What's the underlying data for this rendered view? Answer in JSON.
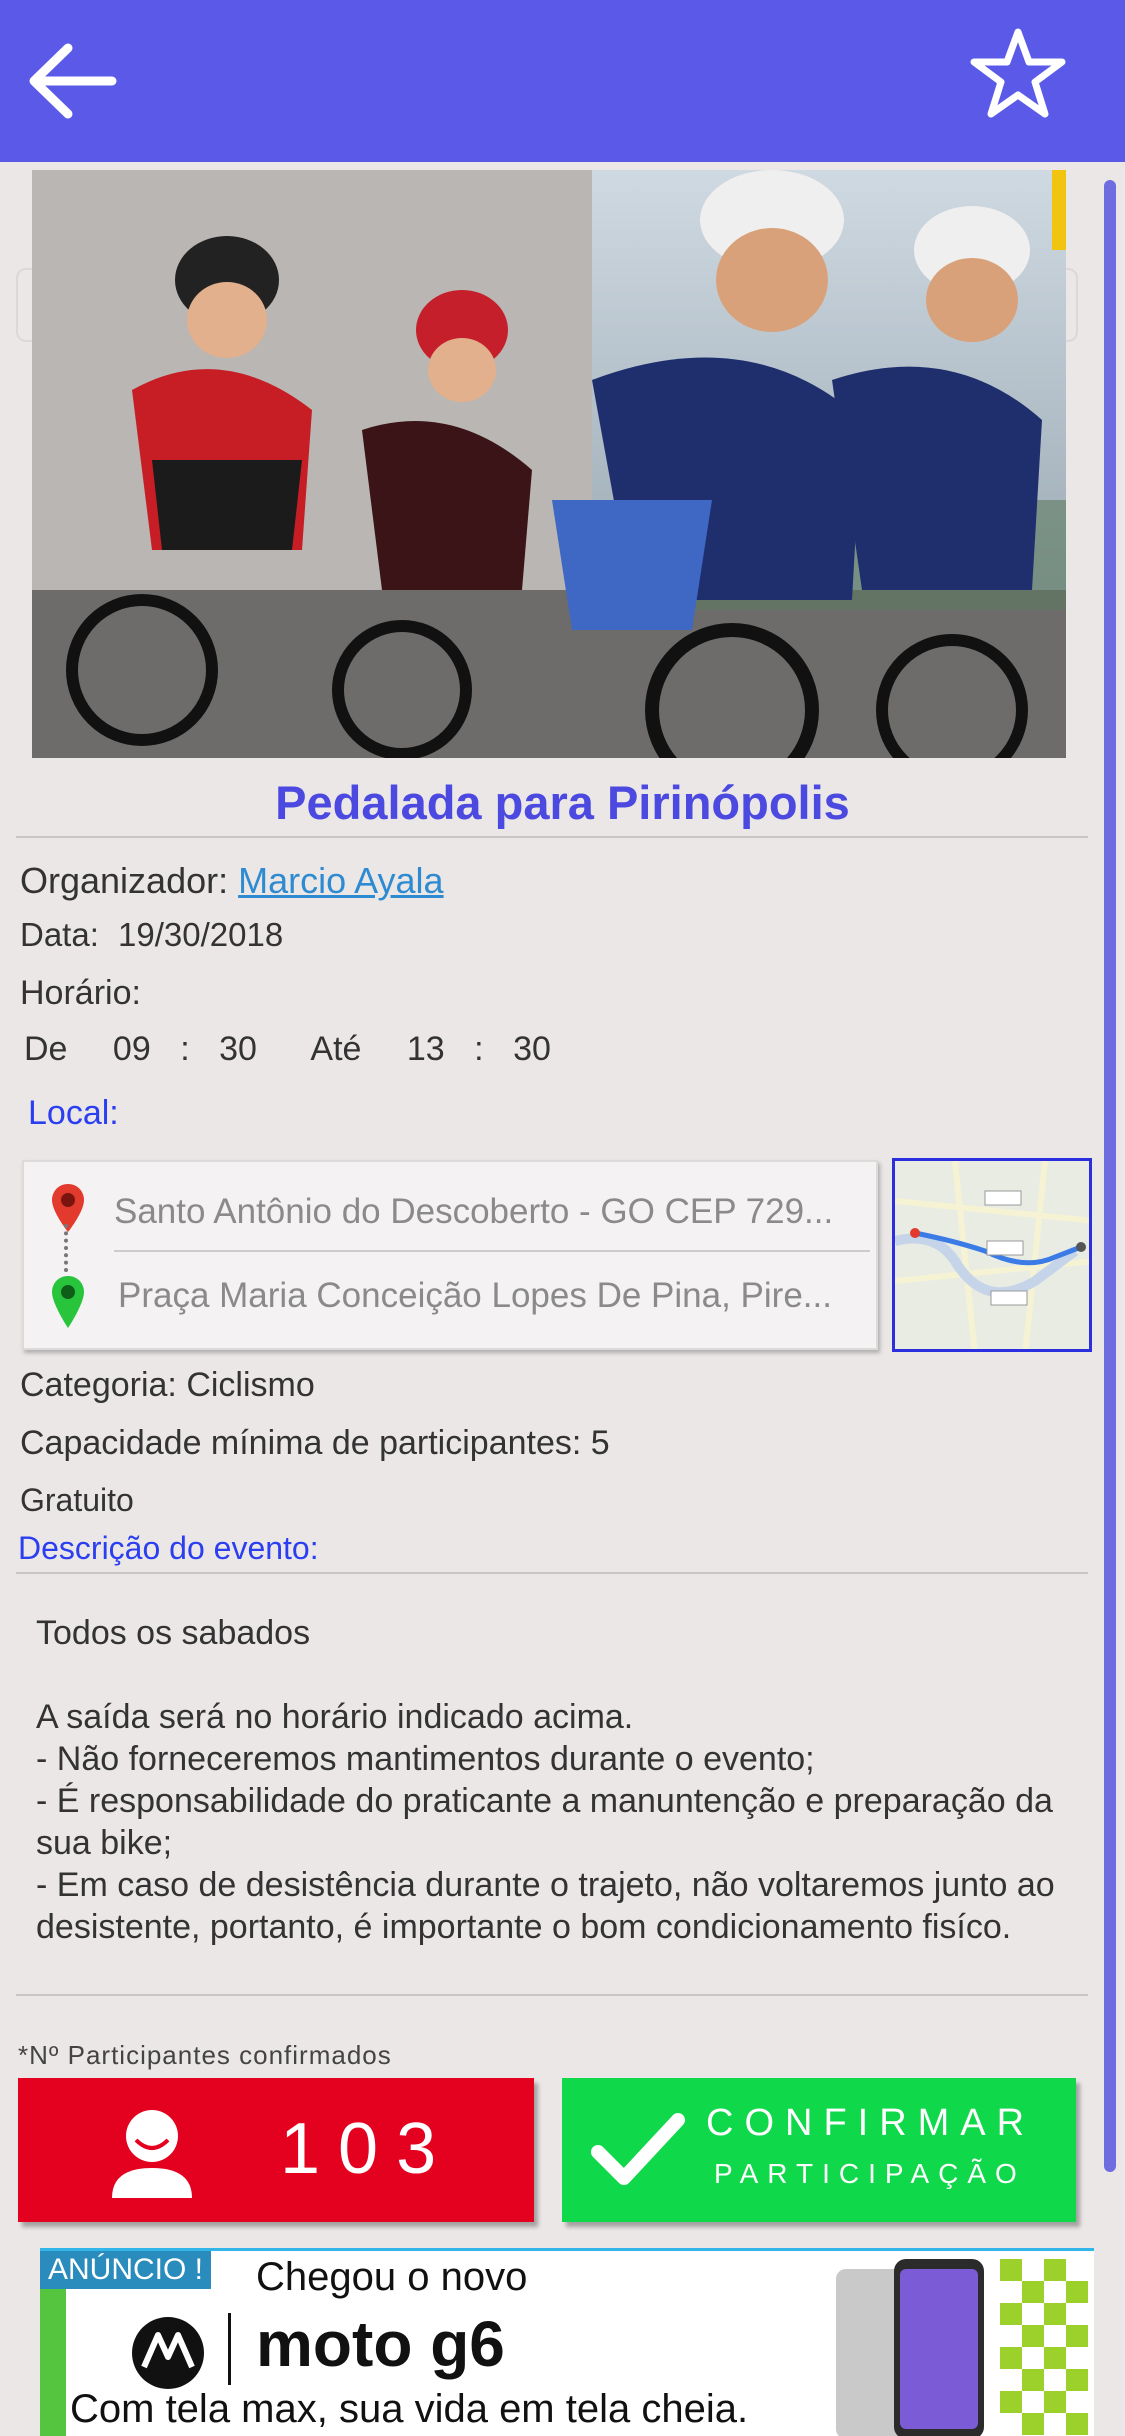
{
  "header": {
    "back_icon": "arrow-left-icon",
    "favorite_icon": "star-outline-icon",
    "bar_color": "#5b5ae8"
  },
  "event": {
    "title": "Pedalada para Pirinópolis",
    "organizer_label": "Organizador:",
    "organizer_name": "Marcio Ayala",
    "date_label": "Data:",
    "date_value": "19/30/2018",
    "time_label": "Horário:",
    "time_from_label": "De",
    "start_hour": "09",
    "start_min": "30",
    "time_to_label": "Até",
    "end_hour": "13",
    "end_min": "30",
    "time_sep": ":",
    "local_label": "Local:",
    "origin": "Santo Antônio do Descoberto - GO CEP 729...",
    "destination": "Praça Maria Conceição Lopes De Pina, Pire...",
    "category_label": "Categoria:",
    "category_value": "Ciclismo",
    "capacity_label": "Capacidade mínima de participantes:",
    "capacity_value": "5",
    "price": "Gratuito",
    "description_label": "Descrição do evento:",
    "description_lines": [
      "Todos os sabados",
      "",
      "A saída será no horário indicado acima.",
      "- Não forneceremos mantimentos durante o evento;",
      "- É responsabilidade do praticante a manuntenção e preparação da sua bike;",
      "- Em caso de desistência durante o trajeto, não voltaremos junto ao desistente, portanto, é importante o bom condicionamento fisíco."
    ]
  },
  "participants": {
    "note": "*Nº Participantes confirmados",
    "count": "103",
    "confirm_line1": "CONFIRMAR",
    "confirm_line2": "PARTICIPAÇÃO",
    "count_color": "#e4001f",
    "confirm_color": "#0fd84a"
  },
  "ad": {
    "tag": "ANÚNCIO !",
    "headline": "Chegou o novo",
    "brand": "moto g6",
    "tagline": "Com tela max, sua vida em tela cheia."
  }
}
